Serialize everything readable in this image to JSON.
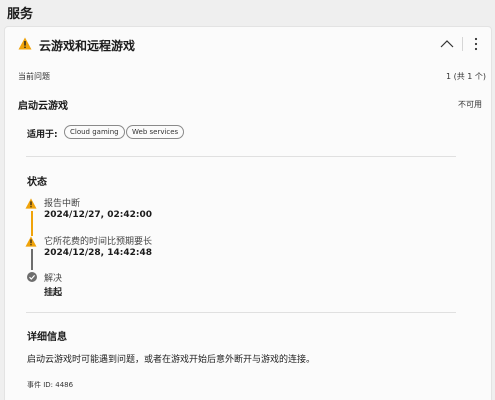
{
  "section": {
    "title": "服务"
  },
  "card": {
    "title": "云游戏和远程游戏",
    "current_issues_label": "当前问题",
    "count": "1 (共 1 个)",
    "issue_title": "启动云游戏",
    "issue_state": "不可用",
    "applies_to_label": "适用于:",
    "applies_to_chips": [
      "Cloud gaming",
      "Web services"
    ],
    "status_heading": "状态",
    "timeline": [
      {
        "label": "报告中断",
        "value": "2024/12/27, 02:42:00"
      },
      {
        "label": "它所花费的时间比预期要长",
        "value": "2024/12/28, 14:42:48"
      },
      {
        "label": "解决",
        "value": "挂起"
      }
    ],
    "details_heading": "详细信息",
    "details_text": "启动云游戏时可能遇到问题，或者在游戏开始后意外断开与游戏的连接。",
    "event_id": "事件 ID: 4486"
  },
  "colors": {
    "warning": "#f0a30a",
    "timeline_gray": "#6d6d6d",
    "card_bg": "#fbfbfb",
    "page_bg": "#efefef"
  },
  "icons": {
    "title": "warning-icon",
    "collapse": "chevron-up-icon",
    "more": "more-vertical-icon",
    "step1": "warning-icon",
    "step2": "warning-icon",
    "step3": "checkmark-icon"
  }
}
